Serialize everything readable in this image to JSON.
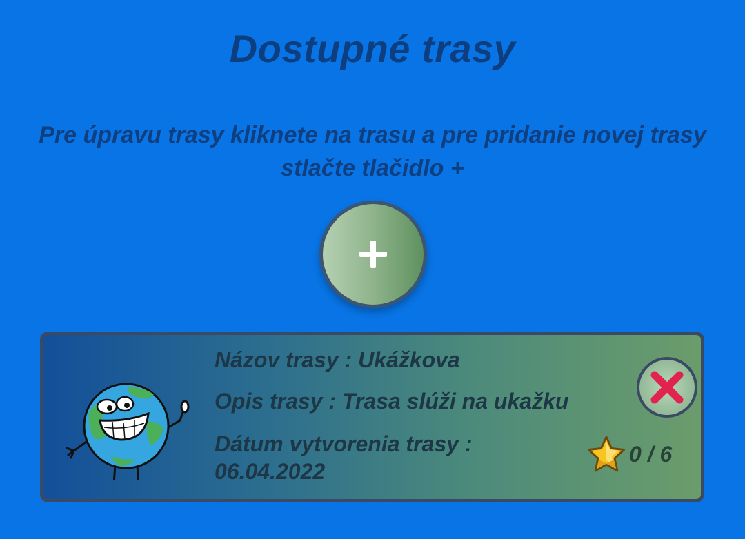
{
  "header": {
    "title": "Dostupné trasy",
    "instructions": "Pre úpravu trasy kliknete na trasu a pre pridanie novej trasy stlačte tlačidlo +"
  },
  "add_button": {
    "icon": "plus-icon",
    "color": "#ffffff"
  },
  "routes": [
    {
      "name_line": "Názov trasy : Ukážkova",
      "description_line": "Opis trasy : Trasa slúži na ukažku",
      "date_label": "Dátum vytvorenia trasy :",
      "date_value": "06.04.2022",
      "rating_text": "0 / 6",
      "rating_icon": "star-icon",
      "delete_icon": "close-icon",
      "avatar_icon": "globe-character-icon"
    }
  ],
  "colors": {
    "background": "#0874e5",
    "title": "#0d3f80",
    "delete_x": "#e0244f",
    "star": "#f5c21b"
  }
}
